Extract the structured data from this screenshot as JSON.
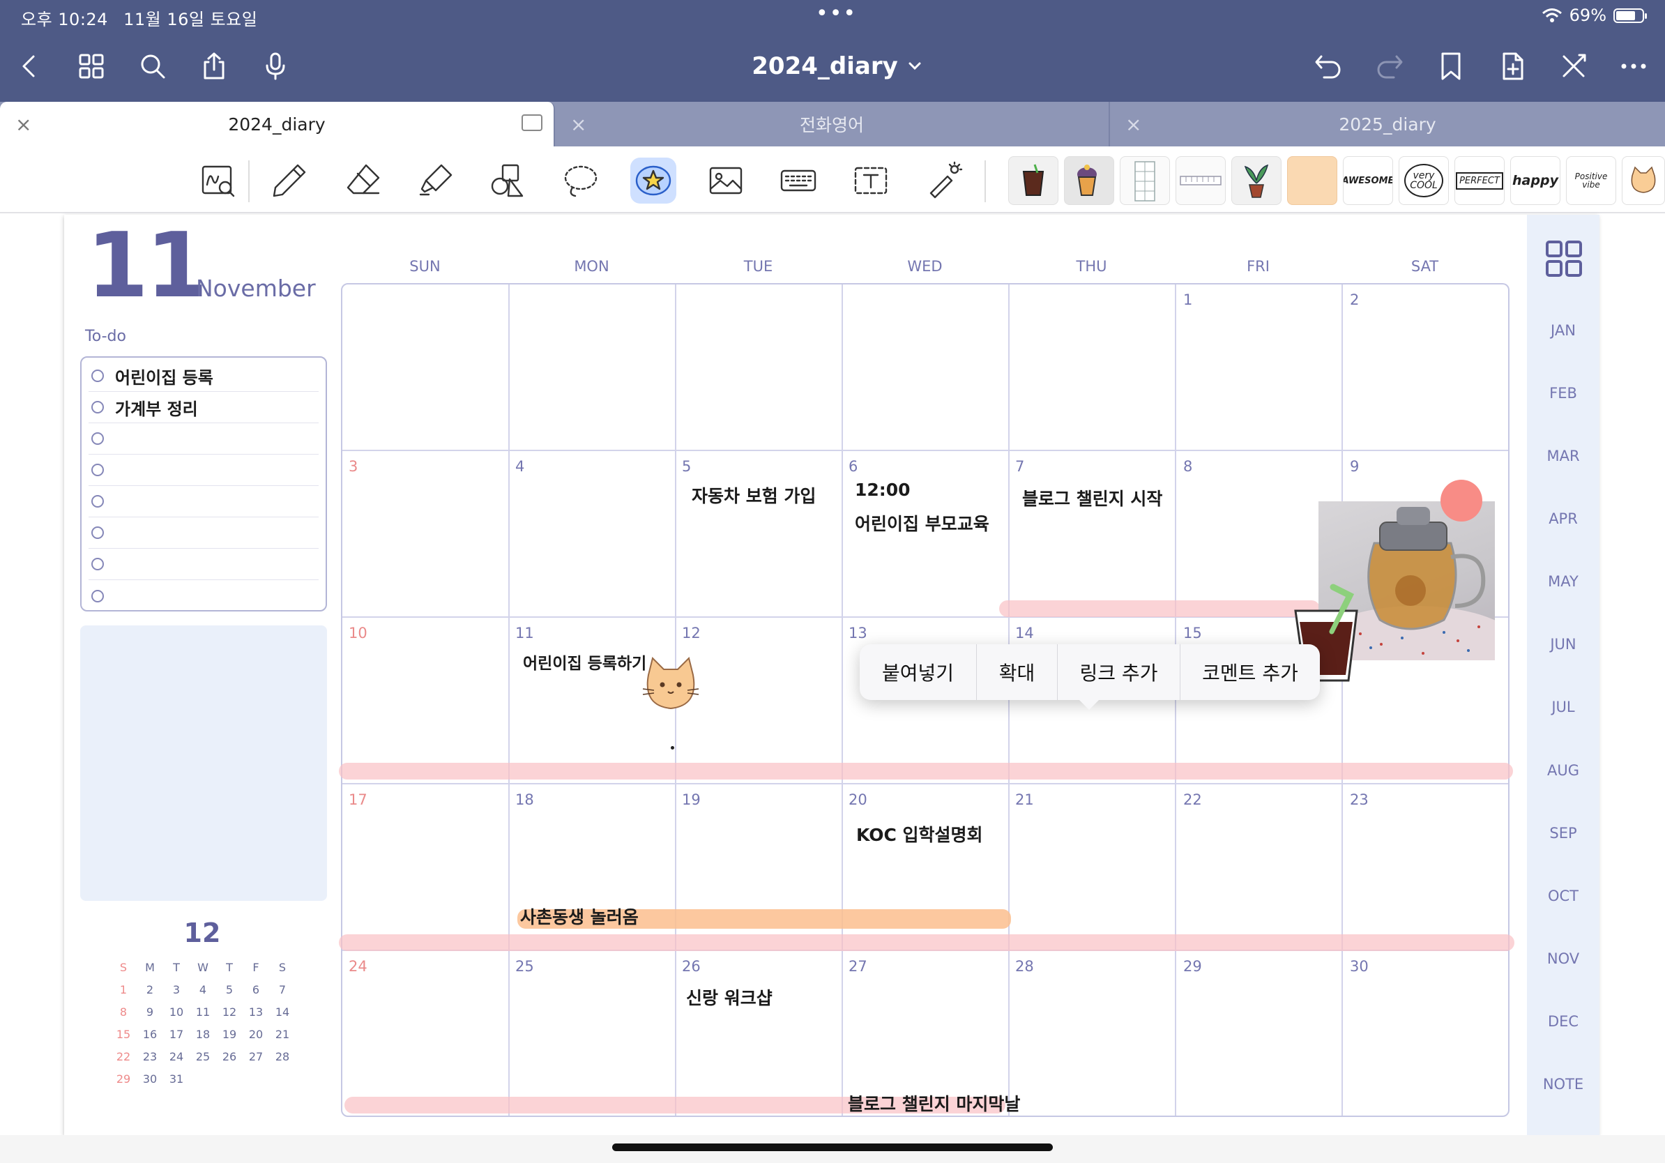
{
  "status": {
    "time": "오후 10:24",
    "date": "11월 16일 토요일",
    "dots": "•••",
    "battery": "69%"
  },
  "toolbar": {
    "title": "2024_diary",
    "left_icons": [
      "back-icon",
      "grid-icon",
      "search-icon",
      "share-icon",
      "mic-icon"
    ],
    "right_icons": [
      "undo-icon",
      "redo-icon",
      "bookmark-icon",
      "add-page-icon",
      "close-toolbar-icon",
      "more-icon"
    ]
  },
  "tabs": [
    {
      "label": "2024_diary",
      "active": true
    },
    {
      "label": "전화영어",
      "active": false
    },
    {
      "label": "2025_diary",
      "active": false
    }
  ],
  "tools": [
    "handwriting-zoom",
    "pen",
    "eraser",
    "highlighter",
    "shapes",
    "lasso",
    "sticker",
    "image",
    "keyboard",
    "text",
    "laser-pointer"
  ],
  "stickers": [
    "iced-coffee",
    "cupcake",
    "grid-note",
    "ruler-strip",
    "potted-plant",
    "peach-note",
    "AWESOME",
    "very COOL",
    "PERFECT",
    "happy",
    "Positive vibe",
    "cat"
  ],
  "page": {
    "day": "11",
    "month": "November",
    "todo_label": "To-do",
    "todos": [
      "어린이집 등록",
      "가계부 정리",
      "",
      "",
      "",
      "",
      "",
      ""
    ]
  },
  "mini_calendar": {
    "title": "12",
    "weekdays": [
      "S",
      "M",
      "T",
      "W",
      "T",
      "F",
      "S"
    ],
    "weeks": [
      [
        "1",
        "2",
        "3",
        "4",
        "5",
        "6",
        "7"
      ],
      [
        "8",
        "9",
        "10",
        "11",
        "12",
        "13",
        "14"
      ],
      [
        "15",
        "16",
        "17",
        "18",
        "19",
        "20",
        "21"
      ],
      [
        "22",
        "23",
        "24",
        "25",
        "26",
        "27",
        "28"
      ],
      [
        "29",
        "30",
        "31",
        "",
        "",
        "",
        ""
      ]
    ]
  },
  "calendar": {
    "weekdays": [
      "SUN",
      "MON",
      "TUE",
      "WED",
      "THU",
      "FRI",
      "SAT"
    ],
    "weeks": [
      [
        "",
        "",
        "",
        "",
        "",
        "1",
        "2"
      ],
      [
        "3",
        "4",
        "5",
        "6",
        "7",
        "8",
        "9"
      ],
      [
        "10",
        "11",
        "12",
        "13",
        "14",
        "15",
        ""
      ],
      [
        "17",
        "18",
        "19",
        "20",
        "21",
        "22",
        "23"
      ],
      [
        "24",
        "25",
        "26",
        "27",
        "28",
        "29",
        "30"
      ]
    ],
    "events": {
      "car_insurance": "자동차 보험 가입",
      "wed6_time": "12:00",
      "parent_edu": "어린이집 부모교육",
      "blog_start": "블로그 챌린지 시작",
      "daycare_reg": "어린이집 등록하기",
      "koc": "KOC 입학설명회",
      "cousin": "사촌동생 놀러옴",
      "workshop": "신랑 워크샵",
      "blog_end": "블로그 챌린지 마지막날"
    }
  },
  "month_nav": [
    "JAN",
    "FEB",
    "MAR",
    "APR",
    "MAY",
    "JUN",
    "JUL",
    "AUG",
    "SEP",
    "OCT",
    "NOV",
    "DEC",
    "NOTE"
  ],
  "context_menu": [
    "붙여넣기",
    "확대",
    "링크 추가",
    "코멘트 추가"
  ],
  "colors": {
    "header": "#4e5a86",
    "tab_bar": "#8e96b6",
    "accent": "#5e5f9c",
    "highlight_pink": "#fac0c4",
    "highlight_orange": "#fbc9a2",
    "note_bg": "#eaf0fa"
  }
}
